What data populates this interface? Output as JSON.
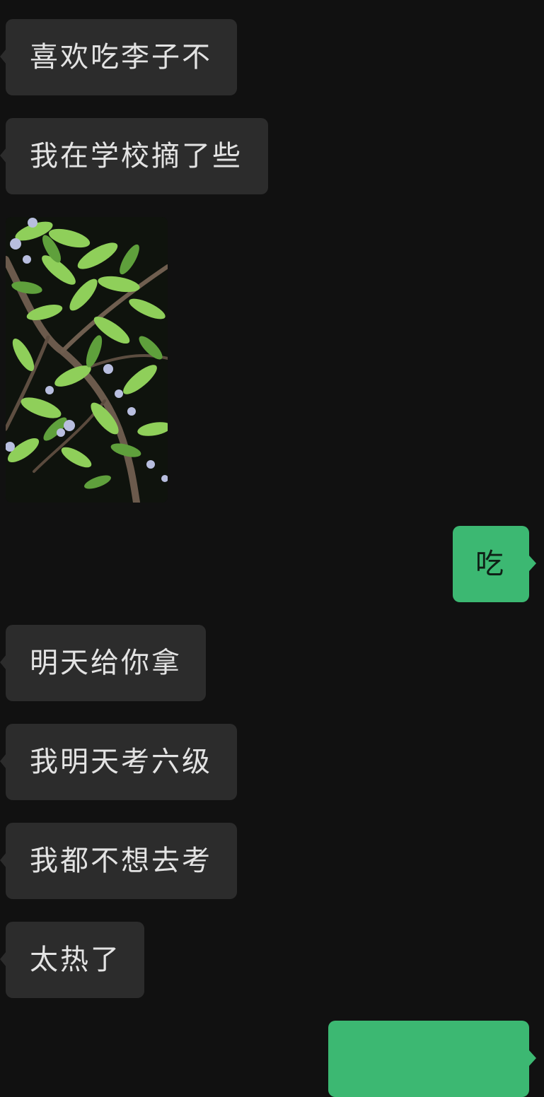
{
  "messages": [
    {
      "side": "in",
      "text": "喜欢吃李子不"
    },
    {
      "side": "in",
      "text": "我在学校摘了些"
    },
    {
      "side": "in",
      "type": "image",
      "content": "photo"
    },
    {
      "side": "out",
      "text": "吃"
    },
    {
      "side": "in",
      "text": "明天给你拿"
    },
    {
      "side": "in",
      "text": "我明天考六级"
    },
    {
      "side": "in",
      "text": "我都不想去考"
    },
    {
      "side": "in",
      "text": "太热了"
    },
    {
      "side": "out",
      "text": ""
    }
  ],
  "colors": {
    "background": "#111111",
    "incoming_bubble": "#2c2c2c",
    "outgoing_bubble": "#3cb872",
    "incoming_text": "#e3e3e3"
  }
}
